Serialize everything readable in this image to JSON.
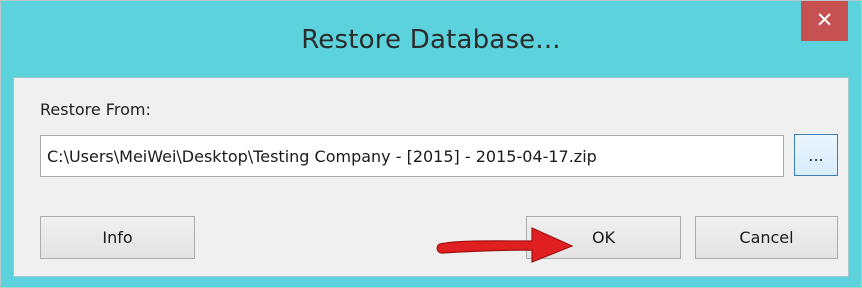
{
  "window": {
    "title": "Restore Database...",
    "close_label": "✕"
  },
  "form": {
    "restore_from_label": "Restore From:",
    "path_value": "C:\\Users\\MeiWei\\Desktop\\Testing Company - [2015] - 2015-04-17.zip",
    "browse_label": "..."
  },
  "buttons": {
    "info_label": "Info",
    "ok_label": "OK",
    "cancel_label": "Cancel"
  },
  "annotation": {
    "arrow_color": "#e02020",
    "points_to": "ok-button"
  },
  "colors": {
    "titlebar": "#5cd2dd",
    "close_button": "#c75050",
    "client_background": "#f0f0f0"
  }
}
